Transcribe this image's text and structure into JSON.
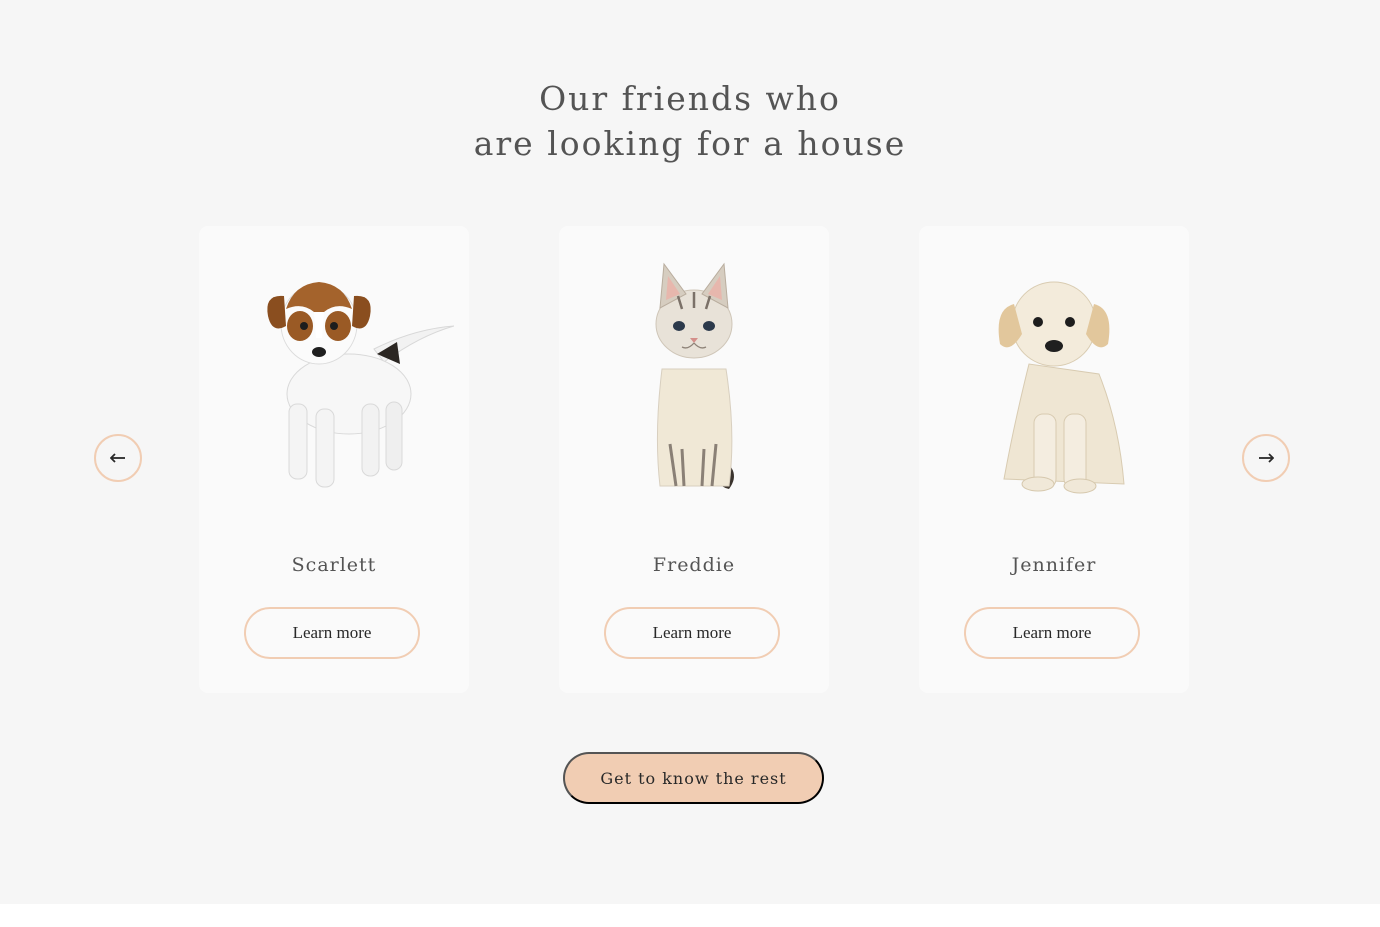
{
  "section": {
    "title_line1": "Our friends who",
    "title_line2": "are looking for a house"
  },
  "slider": {
    "prev_icon": "arrow-left-icon",
    "next_icon": "arrow-right-icon",
    "pets": [
      {
        "name": "Scarlett",
        "photo": "jack-russell-puppy",
        "button_label": "Learn more"
      },
      {
        "name": "Freddie",
        "photo": "tabby-kitten",
        "button_label": "Learn more"
      },
      {
        "name": "Jennifer",
        "photo": "golden-retriever-puppy",
        "button_label": "Learn more"
      }
    ]
  },
  "cta": {
    "label": "Get to know the rest"
  },
  "colors": {
    "accent": "#f1cdb3",
    "section_bg": "#f6f6f6",
    "card_bg": "#fafafa",
    "text": "#545454"
  }
}
